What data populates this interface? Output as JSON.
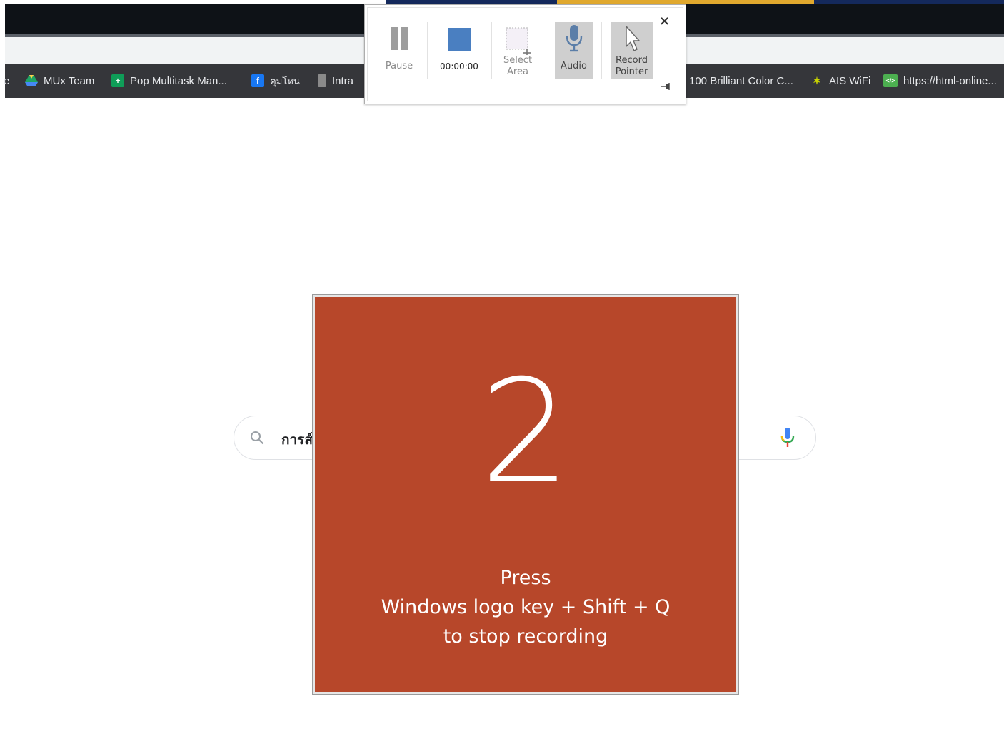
{
  "browser": {
    "bookmarks": [
      {
        "label": "e",
        "icon": "partial-icon"
      },
      {
        "label": "MUx Team",
        "icon": "google-drive-icon"
      },
      {
        "label": "Pop Multitask Man...",
        "icon": "sheets-plus-icon"
      },
      {
        "label": "คุมโหน",
        "icon": "facebook-icon"
      },
      {
        "label": "Intra",
        "icon": "intra-icon"
      },
      {
        "label": "100 Brilliant Color C...",
        "icon": ""
      },
      {
        "label": "AIS WiFi",
        "icon": "ais-wifi-icon"
      },
      {
        "label": "https://html-online...",
        "icon": "html-code-icon"
      }
    ]
  },
  "search": {
    "query_text": "การส์"
  },
  "countdown": {
    "number": "2",
    "line1": "Press",
    "line2": "Windows logo key + Shift + Q",
    "line3": "to stop recording",
    "background_color": "#b7472a"
  },
  "recorder": {
    "pause_label": "Pause",
    "timer": "00:00:00",
    "select_area_line1": "Select",
    "select_area_line2": "Area",
    "audio_label": "Audio",
    "record_pointer_line1": "Record",
    "record_pointer_line2": "Pointer",
    "close_glyph": "×",
    "stop_color": "#4a7fc1"
  }
}
